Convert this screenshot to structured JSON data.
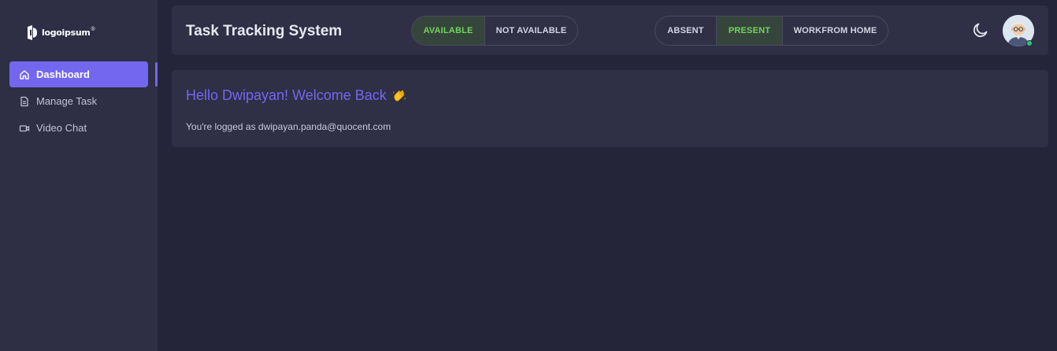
{
  "brand": {
    "logo_text": "logoipsum",
    "logo_mark": "®"
  },
  "sidebar": {
    "items": [
      {
        "label": "Dashboard",
        "icon": "home-icon",
        "active": true
      },
      {
        "label": "Manage Task",
        "icon": "document-icon",
        "active": false
      },
      {
        "label": "Video Chat",
        "icon": "video-camera-icon",
        "active": false
      }
    ]
  },
  "header": {
    "title": "Task Tracking System",
    "availability": {
      "options": [
        "AVAILABLE",
        "NOT AVAILABLE"
      ],
      "selected": "AVAILABLE"
    },
    "attendance": {
      "options": [
        "ABSENT",
        "PRESENT",
        "WORKFROM HOME"
      ],
      "selected": "PRESENT"
    },
    "theme_toggle_icon": "moon-icon",
    "user_status": "online"
  },
  "welcome": {
    "greeting": "Hello Dwipayan! Welcome Back",
    "logged_as": "You're logged as dwipayan.panda@quocent.com"
  },
  "colors": {
    "accent": "#7367f0",
    "selected_text": "#6fd65a",
    "selected_bg": "#36453c",
    "online": "#28c76f"
  }
}
